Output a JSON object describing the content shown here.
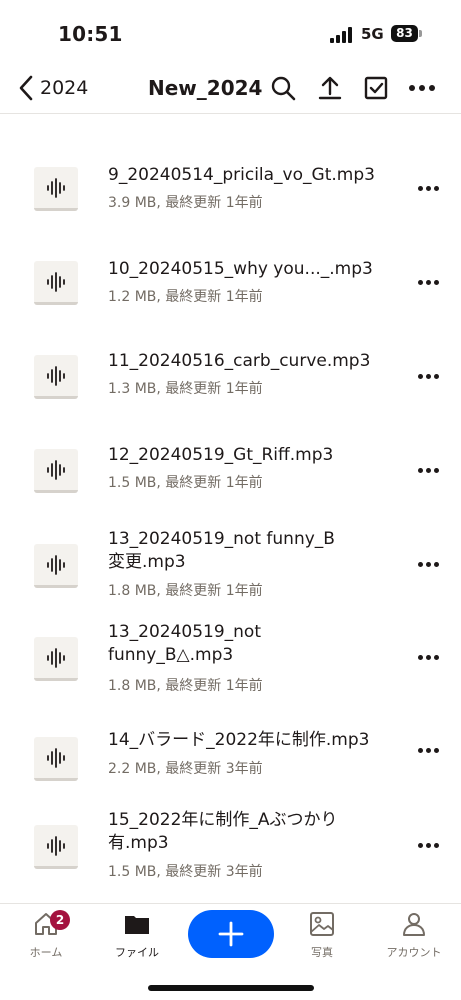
{
  "status_bar": {
    "time": "10:51",
    "network": "5G",
    "battery": "83"
  },
  "header": {
    "back_label": "2024",
    "title": "New_2024"
  },
  "files": [
    {
      "name": "9_20240514_pricila_vo_Gt.mp3",
      "meta": "3.9 MB, 最終更新 1年前"
    },
    {
      "name": "10_20240515_why you..._.mp3",
      "meta": "1.2 MB, 最終更新 1年前"
    },
    {
      "name": "11_20240516_carb_curve.mp3",
      "meta": "1.3 MB, 最終更新 1年前"
    },
    {
      "name": "12_20240519_Gt_Riff.mp3",
      "meta": "1.5 MB, 最終更新 1年前"
    },
    {
      "name_lines": [
        "13_20240519_not funny_B",
        "変更.mp3"
      ],
      "meta": "1.8 MB, 最終更新 1年前"
    },
    {
      "name_lines": [
        "13_20240519_not",
        "funny_B△.mp3"
      ],
      "meta": "1.8 MB, 最終更新 1年前"
    },
    {
      "name": "14_バラード_2022年に制作.mp3",
      "meta": "2.2 MB, 最終更新 3年前"
    },
    {
      "name_lines": [
        "15_2022年に制作_Aぶつかり",
        "有.mp3"
      ],
      "meta": "1.5 MB, 最終更新 3年前"
    }
  ],
  "tab_bar": {
    "home": {
      "label": "ホーム",
      "badge": "2"
    },
    "files": {
      "label": "ファイル"
    },
    "photos": {
      "label": "写真"
    },
    "account": {
      "label": "アカウント"
    }
  },
  "colors": {
    "accent": "#0061fe",
    "badge": "#a4123f",
    "text": "#1e1919",
    "meta": "#736c64"
  }
}
